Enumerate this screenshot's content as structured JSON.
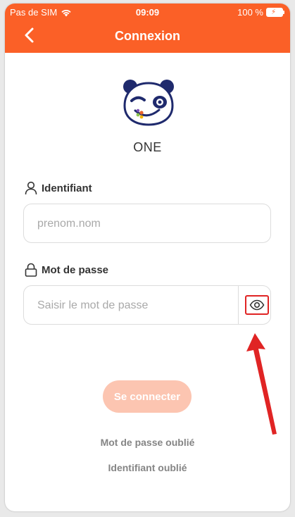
{
  "status_bar": {
    "carrier": "Pas de SIM",
    "time": "09:09",
    "battery": "100 %"
  },
  "header": {
    "title": "Connexion",
    "back_icon": "chevron-left-icon"
  },
  "logo": {
    "icon": "panda-logo-icon",
    "name": "ONE"
  },
  "form": {
    "username": {
      "label": "Identifiant",
      "icon": "user-icon",
      "placeholder": "prenom.nom",
      "value": ""
    },
    "password": {
      "label": "Mot de passe",
      "icon": "lock-icon",
      "placeholder": "Saisir le mot de passe",
      "value": "",
      "toggle_icon": "eye-icon"
    }
  },
  "actions": {
    "login_label": "Se connecter",
    "forgot_password": "Mot de passe oublié",
    "forgot_username": "Identifiant oublié"
  },
  "colors": {
    "brand": "#fb6027",
    "button_disabled": "#fcc5b1",
    "annotation": "#e02424",
    "link": "#858585"
  }
}
